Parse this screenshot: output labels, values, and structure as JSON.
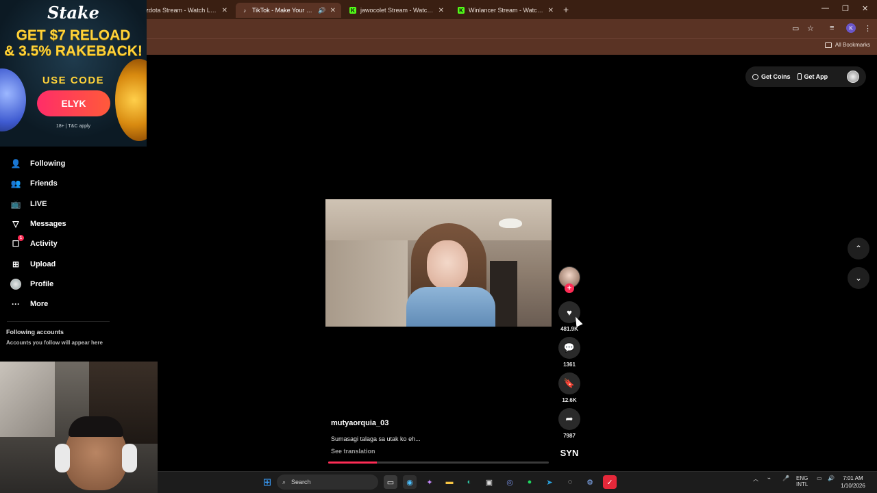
{
  "browser": {
    "tabs": [
      {
        "title": "kzdota Stream - Watch Live o",
        "favicon": "kick",
        "active": false
      },
      {
        "title": "TikTok - Make Your Day",
        "favicon": "tiktok",
        "active": true,
        "audio": true
      },
      {
        "title": "jawocolet Stream - Watch Live o",
        "favicon": "kick",
        "active": false
      },
      {
        "title": "Winlancer Stream - Watch Live o",
        "favicon": "kick",
        "active": false
      }
    ],
    "new_tab_symbol": "+",
    "window_controls": {
      "minimize": "—",
      "restore": "❐",
      "close": "✕"
    },
    "profile_initial": "K",
    "bookmarks_label": "All Bookmarks"
  },
  "ad": {
    "logo": "Stake",
    "headline_line1": "GET $7 RELOAD",
    "headline_line2": "& 3.5% RAKEBACK!",
    "use_code": "USE CODE",
    "code": "ELYK",
    "terms": "18+ | T&C apply"
  },
  "sidebar": {
    "items": [
      {
        "label": "Following",
        "icon": "following-icon"
      },
      {
        "label": "Friends",
        "icon": "friends-icon"
      },
      {
        "label": "LIVE",
        "icon": "live-icon"
      },
      {
        "label": "Messages",
        "icon": "messages-icon"
      },
      {
        "label": "Activity",
        "icon": "activity-icon",
        "badge": "1"
      },
      {
        "label": "Upload",
        "icon": "upload-icon"
      },
      {
        "label": "Profile",
        "icon": "avatar"
      },
      {
        "label": "More",
        "icon": "more-icon"
      }
    ],
    "following_accounts_title": "Following accounts",
    "following_accounts_sub": "Accounts you follow will appear here"
  },
  "tiktok": {
    "get_coins": "Get Coins",
    "get_app": "Get App",
    "video": {
      "author": "mutyaorquia_03",
      "caption": "Sumasagi talaga sa utak ko eh...",
      "see_translation": "See translation",
      "progress": 0.22
    },
    "actions": {
      "likes": "481.9K",
      "comments": "1361",
      "saves": "12.6K",
      "shares": "7987",
      "sound": "SYN"
    }
  },
  "taskbar": {
    "search_label": "Search",
    "language_line1": "ENG",
    "language_line2": "INTL",
    "time": "7:01 AM",
    "date": "1/10/2026"
  },
  "colors": {
    "tiktok_accent": "#fe2c55",
    "browser_frame": "#5a3324",
    "ad_yellow": "#ffd23a"
  }
}
